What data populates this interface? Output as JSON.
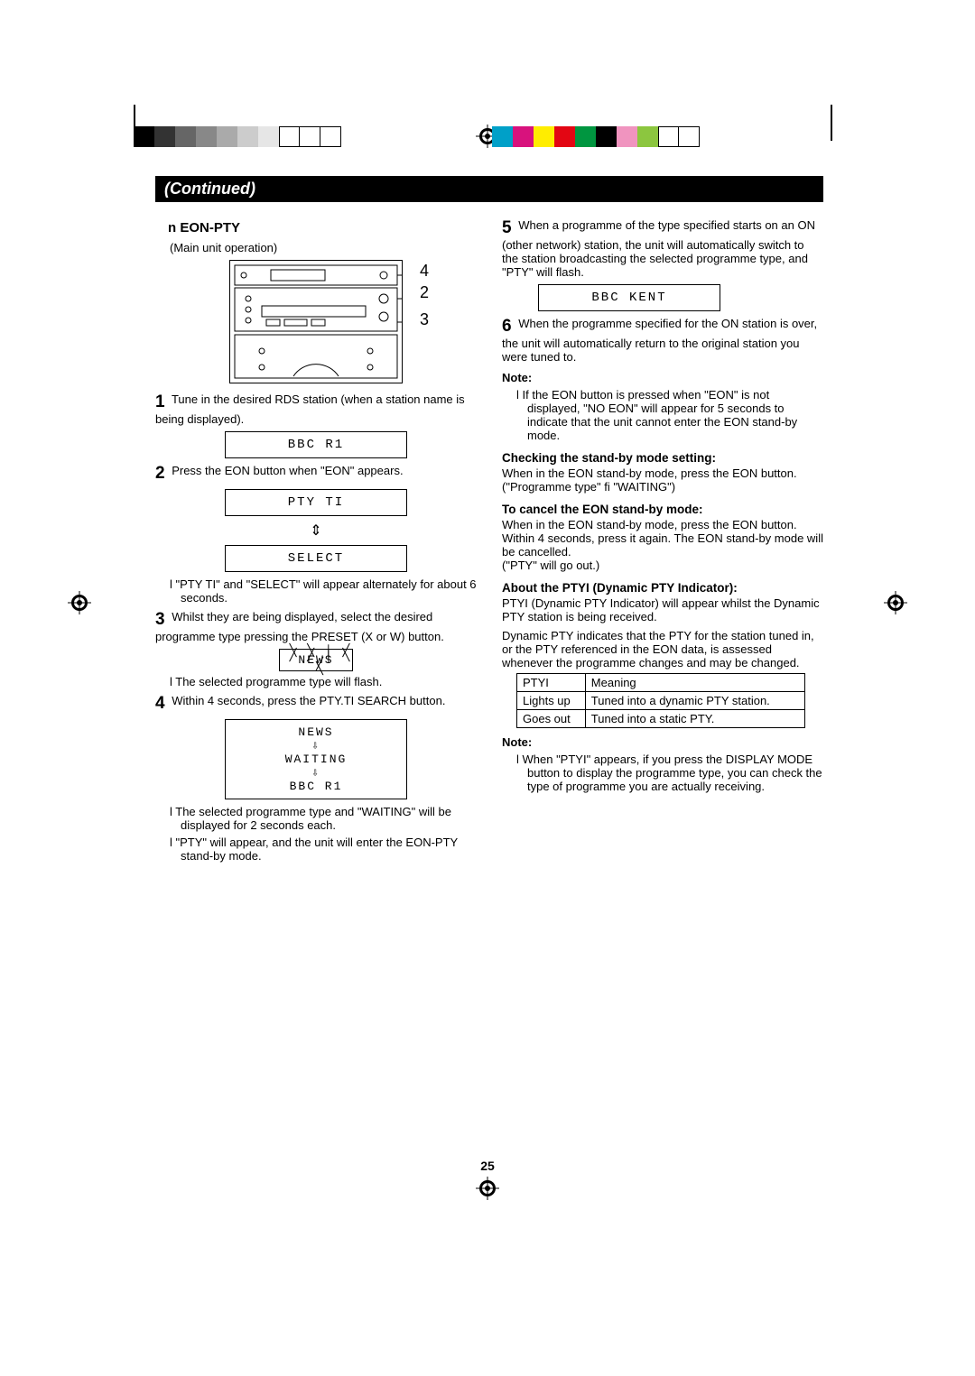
{
  "page_number": "25",
  "continued": "(Continued)",
  "left": {
    "eon_marker": "n",
    "eon_title": "EON-PTY",
    "main_unit_label": "(Main unit operation)",
    "callouts": [
      "4",
      "2",
      "3"
    ],
    "step1": {
      "num": "1",
      "text": "Tune in the desired RDS station (when a station name is being displayed)."
    },
    "lcd1": "BBC R1",
    "step2": {
      "num": "2",
      "text": "Press the EON button when \"EON\" appears."
    },
    "lcd2a": "PTY TI",
    "lcd2b": "SELECT",
    "bullet2": "\"PTY TI\" and \"SELECT\" will appear alternately for about 6 seconds.",
    "step3": {
      "num": "3",
      "text": "Whilst they are being displayed, select the desired programme type pressing the PRESET (X or W) button."
    },
    "lcd3": "NEWS",
    "bullet3": "The selected programme type will flash.",
    "step4": {
      "num": "4",
      "text": "Within 4 seconds, press the PTY.TI SEARCH button."
    },
    "lcd4a": "NEWS",
    "lcd4b": "WAITING",
    "lcd4c": "BBC R1",
    "bullet4a": "The selected programme type and \"WAITING\" will be displayed for 2 seconds each.",
    "bullet4b": "\"PTY\" will appear, and the unit will enter the EON-PTY stand-by mode."
  },
  "right": {
    "step5": {
      "num": "5",
      "text": "When a programme of the type specified starts on an ON (other network) station, the unit will automatically switch to the station broadcasting the selected programme type, and \"PTY\" will flash."
    },
    "lcd5": "BBC KENT",
    "step6": {
      "num": "6",
      "text": "When the programme specified for the ON station is over, the unit will automatically return to the original station you were tuned to."
    },
    "note1_label": "Note:",
    "note1_bullet": "If the EON button is pressed when \"EON\" is not displayed, \"NO EON\" will appear for 5 seconds to indicate that the unit cannot enter the EON stand-by mode.",
    "check_heading": "Checking the stand-by mode setting:",
    "check_text": "When in the EON stand-by mode, press the EON button.",
    "check_text2": "(\"Programme type\" fi \"WAITING\")",
    "cancel_heading": "To cancel the EON stand-by mode:",
    "cancel_text": "When in the EON stand-by mode, press the EON button. Within 4 seconds, press it again. The EON stand-by mode will be cancelled.",
    "cancel_text2": "(\"PTY\" will go out.)",
    "ptyi_heading": "About the PTYI (Dynamic PTY Indicator):",
    "ptyi_text1": "PTYI (Dynamic PTY Indicator) will appear whilst the Dynamic PTY station is being received.",
    "ptyi_text2": "Dynamic PTY indicates that the PTY for the station tuned in, or the PTY referenced in the EON data, is assessed whenever the programme changes and may be changed.",
    "table": {
      "h1": "PTYI",
      "h2": "Meaning",
      "r1c1": "Lights up",
      "r1c2": "Tuned into a dynamic PTY station.",
      "r2c1": "Goes out",
      "r2c2": "Tuned into a static PTY."
    },
    "note2_label": "Note:",
    "note2_bullet": "When \"PTYI\" appears, if you press the DISPLAY MODE button to display the programme type, you can check the type of programme you are actually receiving."
  },
  "colorbars_gray": [
    "#000",
    "#333",
    "#666",
    "#888",
    "#aaa",
    "#ccc",
    "#e6e6e6",
    "#fff",
    "#fff",
    "#fff"
  ],
  "colorbars_rgb": [
    "#00a0c8",
    "#d8127d",
    "#ffed00",
    "#e30613",
    "#009640",
    "#000",
    "#f094bf",
    "#00aa4f",
    "#fff",
    "#fff"
  ]
}
